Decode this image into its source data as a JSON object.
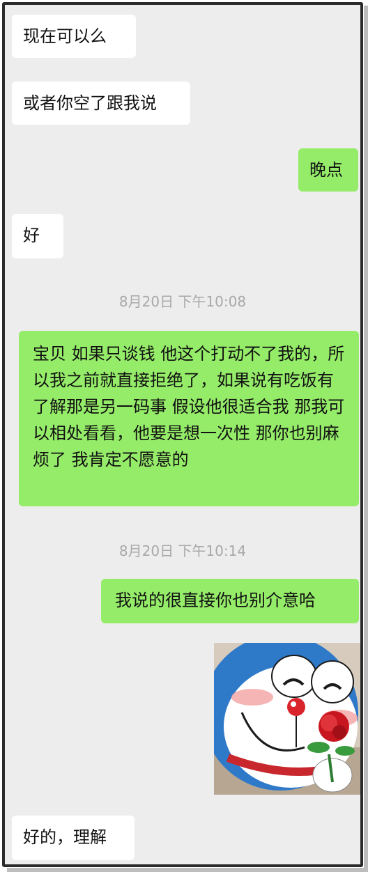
{
  "messages": [
    {
      "side": "in",
      "text": "现在可以么"
    },
    {
      "side": "in",
      "text": "或者你空了跟我说"
    },
    {
      "side": "out",
      "text": "晚点"
    },
    {
      "side": "in",
      "text": "好"
    },
    {
      "side": "time",
      "text": "8月20日 下午10:08"
    },
    {
      "side": "out",
      "text": "宝贝  如果只谈钱 他这个打动不了我的，所以我之前就直接拒绝了，如果说有吃饭有了解那是另一码事 假设他很适合我 那我可以相处看看，他要是想一次性 那你也别麻烦了 我肯定不愿意的"
    },
    {
      "side": "time",
      "text": "8月20日 下午10:14"
    },
    {
      "side": "out",
      "text": "我说的很直接你也别介意哈"
    },
    {
      "side": "out",
      "sticker": "doraemon-rose-sticker"
    },
    {
      "side": "in",
      "text": "好的，理解"
    }
  ],
  "colors": {
    "incoming": "#ffffff",
    "outgoing": "#95ec69",
    "background": "#ededed",
    "timestamp": "#a8a8a8"
  }
}
